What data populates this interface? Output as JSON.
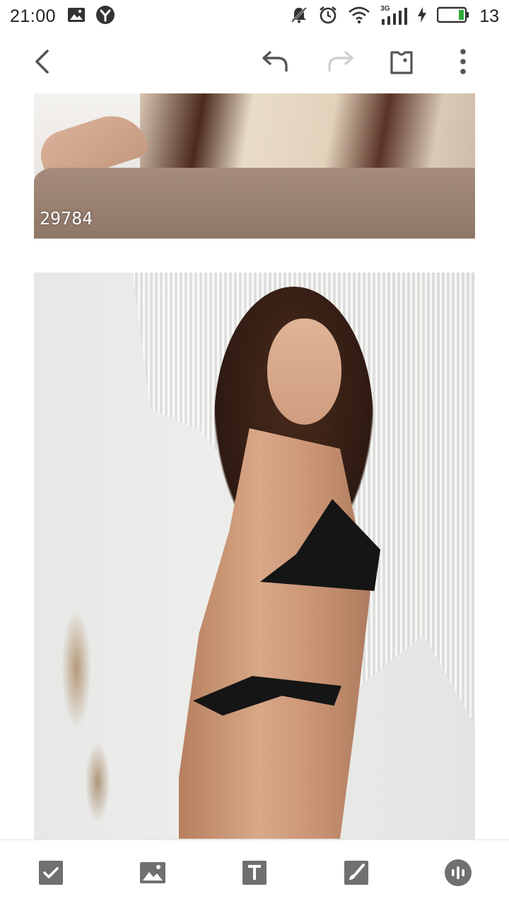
{
  "status_bar": {
    "time": "21:00",
    "battery_level": "13",
    "network_type": "3G",
    "icons": [
      "image-notification-icon",
      "yandex-browser-icon",
      "mute-icon",
      "alarm-icon",
      "wifi-icon",
      "signal-icon",
      "charging-icon",
      "battery-icon"
    ]
  },
  "toolbar": {
    "icons": [
      "back-icon",
      "undo-icon",
      "redo-icon",
      "label-icon",
      "more-vert-icon"
    ],
    "redo_enabled": false
  },
  "content": {
    "images": [
      {
        "id_label": "29784"
      },
      {
        "id_label": ""
      }
    ]
  },
  "bottom_bar": {
    "icons": [
      "checkbox-icon",
      "insert-image-icon",
      "text-format-icon",
      "brush-icon",
      "voice-record-icon"
    ]
  },
  "colors": {
    "icon_active": "#555555",
    "icon_disabled": "#d0d0d0",
    "bottom_icon": "#707070",
    "divider": "#e3e3e3",
    "battery_fill": "#2eaa3c"
  }
}
